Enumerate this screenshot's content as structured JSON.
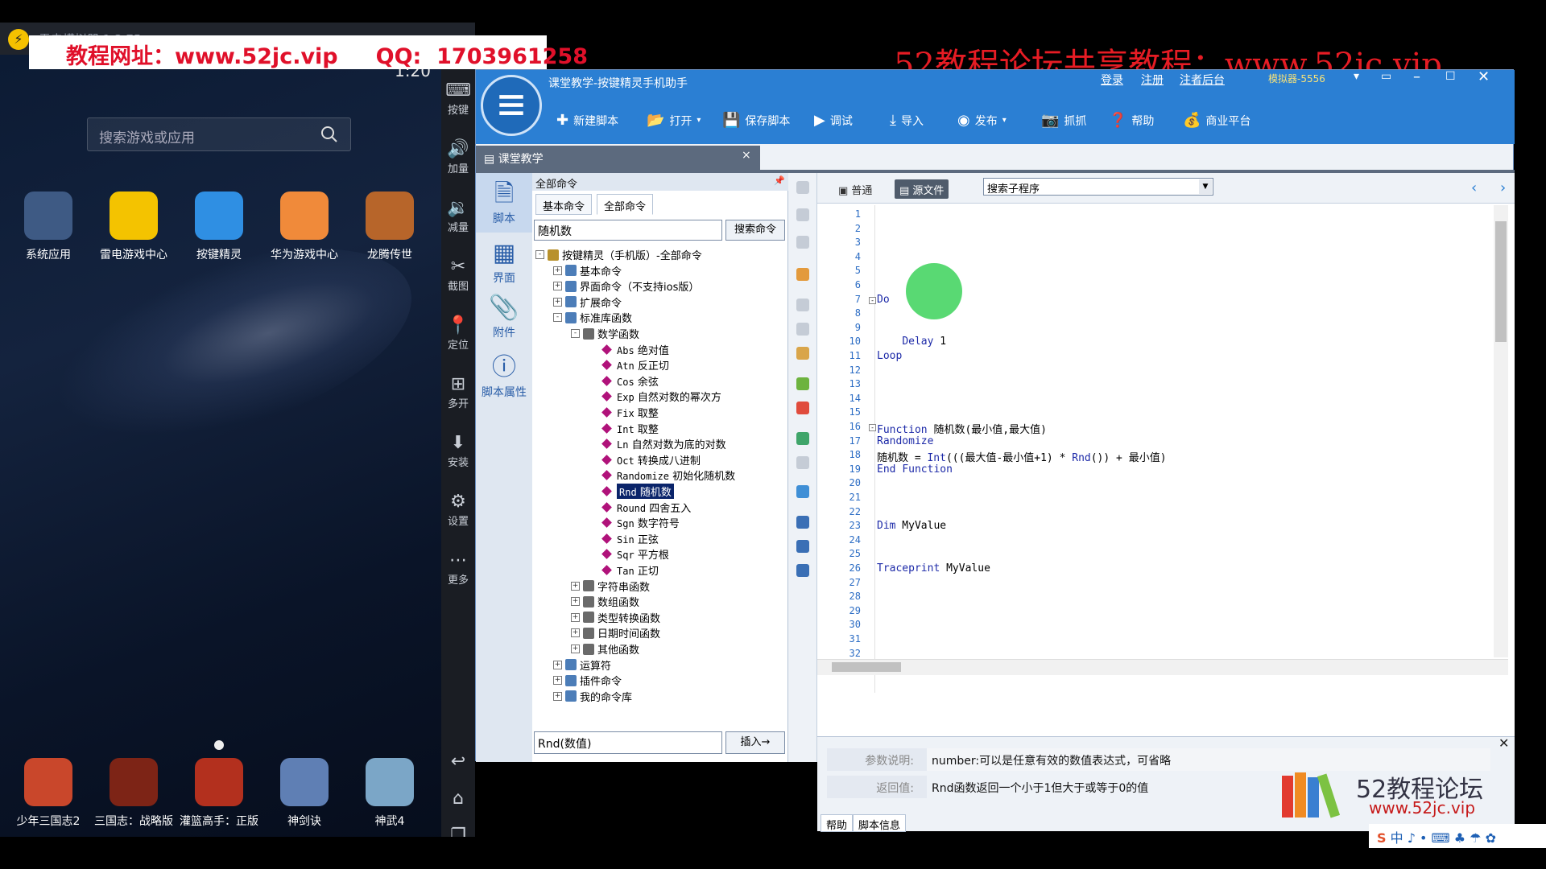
{
  "watermarks": {
    "left_banner": "教程网址：www.52jc.vip     QQ:  1703961258",
    "right_banner": "52教程论坛共享教程：www.52jc.vip"
  },
  "emulator": {
    "title": "雷电模拟器 1.3.75",
    "clock": "1:20",
    "search_placeholder": "搜索游戏或应用",
    "apps_row1": [
      {
        "label": "系统应用",
        "color": "#3e5a84",
        "icon": "grid-icon"
      },
      {
        "label": "雷电游戏中心",
        "color": "#f4c300",
        "icon": "gamepad-icon"
      },
      {
        "label": "按键精灵",
        "color": "#2f8fe3",
        "icon": "monitor-icon"
      },
      {
        "label": "华为游戏中心",
        "color": "#f08a3a",
        "icon": "gamepad-icon"
      },
      {
        "label": "龙腾传世",
        "color": "#b7652a",
        "icon": "face-icon"
      }
    ],
    "apps_row2": [
      {
        "label": "少年三国志2",
        "color": "#c9472b"
      },
      {
        "label": "三国志：战略版",
        "color": "#7d2416"
      },
      {
        "label": "灌篮高手：正版",
        "color": "#b3301e"
      },
      {
        "label": "神剑诀",
        "color": "#5f7fb4"
      },
      {
        "label": "神武4",
        "color": "#7ba6c7"
      }
    ],
    "side_buttons": [
      "按键",
      "加量",
      "减量",
      "截图",
      "定位",
      "多开",
      "安装",
      "设置",
      "更多"
    ]
  },
  "ide": {
    "title": "课堂教学-按键精灵手机助手",
    "top_links": [
      "登录",
      "注册",
      "注者后台"
    ],
    "device": "模拟器-5556",
    "toolbar": [
      "新建脚本",
      "打开",
      "保存脚本",
      "调试",
      "导入",
      "发布",
      "抓抓",
      "帮助",
      "商业平台"
    ],
    "doc_tab": "课堂教学",
    "left_nav": [
      "脚本",
      "界面",
      "附件",
      "脚本属性"
    ],
    "command_panel": {
      "header": "全部命令",
      "tabs": [
        "基本命令",
        "全部命令"
      ],
      "search_value": "随机数",
      "search_button": "搜索命令",
      "tree": [
        {
          "text": "按键精灵（手机版）-全部命令",
          "level": 0,
          "exp": "-"
        },
        {
          "text": "基本命令",
          "level": 1,
          "exp": "+"
        },
        {
          "text": "界面命令（不支持ios版）",
          "level": 1,
          "exp": "+"
        },
        {
          "text": "扩展命令",
          "level": 1,
          "exp": "+"
        },
        {
          "text": "标准库函数",
          "level": 1,
          "exp": "-"
        },
        {
          "text": "数学函数",
          "level": 2,
          "exp": "-"
        },
        {
          "code": "Abs",
          "text": "绝对值",
          "level": 3
        },
        {
          "code": "Atn",
          "text": "反正切",
          "level": 3
        },
        {
          "code": "Cos",
          "text": "余弦",
          "level": 3
        },
        {
          "code": "Exp",
          "text": "自然对数的幂次方",
          "level": 3
        },
        {
          "code": "Fix",
          "text": "取整",
          "level": 3
        },
        {
          "code": "Int",
          "text": "取整",
          "level": 3
        },
        {
          "code": "Ln",
          "text": "自然对数为底的对数",
          "level": 3
        },
        {
          "code": "Oct",
          "text": "转换成八进制",
          "level": 3
        },
        {
          "code": "Randomize",
          "text": "初始化随机数",
          "level": 3
        },
        {
          "code": "Rnd",
          "text": "随机数",
          "level": 3,
          "selected": true
        },
        {
          "code": "Round",
          "text": "四舍五入",
          "level": 3
        },
        {
          "code": "Sgn",
          "text": "数字符号",
          "level": 3
        },
        {
          "code": "Sin",
          "text": "正弦",
          "level": 3
        },
        {
          "code": "Sqr",
          "text": "平方根",
          "level": 3
        },
        {
          "code": "Tan",
          "text": "正切",
          "level": 3
        },
        {
          "text": "字符串函数",
          "level": 2,
          "exp": "+"
        },
        {
          "text": "数组函数",
          "level": 2,
          "exp": "+"
        },
        {
          "text": "类型转换函数",
          "level": 2,
          "exp": "+"
        },
        {
          "text": "日期时间函数",
          "level": 2,
          "exp": "+"
        },
        {
          "text": "其他函数",
          "level": 2,
          "exp": "+"
        },
        {
          "text": "运算符",
          "level": 1,
          "exp": "+"
        },
        {
          "text": "插件命令",
          "level": 1,
          "exp": "+"
        },
        {
          "text": "我的命令库",
          "level": 1,
          "exp": "+"
        }
      ],
      "bottom_input": "Rnd(数值)",
      "insert_button": "插入→"
    },
    "editor": {
      "tabs": [
        "普通",
        "源文件"
      ],
      "subroutine_placeholder": "搜索子程序",
      "line_numbers": [
        "1",
        "2",
        "3",
        "4",
        "5",
        "6",
        "7",
        "8",
        "9",
        "10",
        "11",
        "12",
        "13",
        "14",
        "15",
        "16",
        "17",
        "18",
        "19",
        "20",
        "21",
        "22",
        "23",
        "24",
        "25",
        "26",
        "27",
        "28",
        "29",
        "30",
        "31",
        "32"
      ],
      "code": [
        {
          "line": 7,
          "text": "Do",
          "fold": "-"
        },
        {
          "line": 10,
          "text": "    Delay 1"
        },
        {
          "line": 11,
          "text": "Loop"
        },
        {
          "line": 16,
          "text": "Function 随机数(最小值,最大值)",
          "fold": "-"
        },
        {
          "line": 17,
          "text": "Randomize"
        },
        {
          "line": 18,
          "text": "随机数 = Int(((最大值-最小值+1) * Rnd()) + 最小值)"
        },
        {
          "line": 19,
          "text": "End Function"
        },
        {
          "line": 23,
          "text": "Dim MyValue"
        },
        {
          "line": 26,
          "text": "Traceprint MyValue"
        }
      ]
    },
    "info": {
      "param_label": "参数说明:",
      "param_value": "number:可以是任意有效的数值表达式，可省略",
      "return_label": "返回值:",
      "return_value": "Rnd函数返回一个小于1但大于或等于0的值",
      "tabs": [
        "帮助",
        "脚本信息"
      ]
    }
  },
  "branding": {
    "logo_text": "52教程论坛",
    "logo_url": "www.52jc.vip",
    "tray": "中 ♪ • ⌨ ♣ ☂ ✿"
  }
}
